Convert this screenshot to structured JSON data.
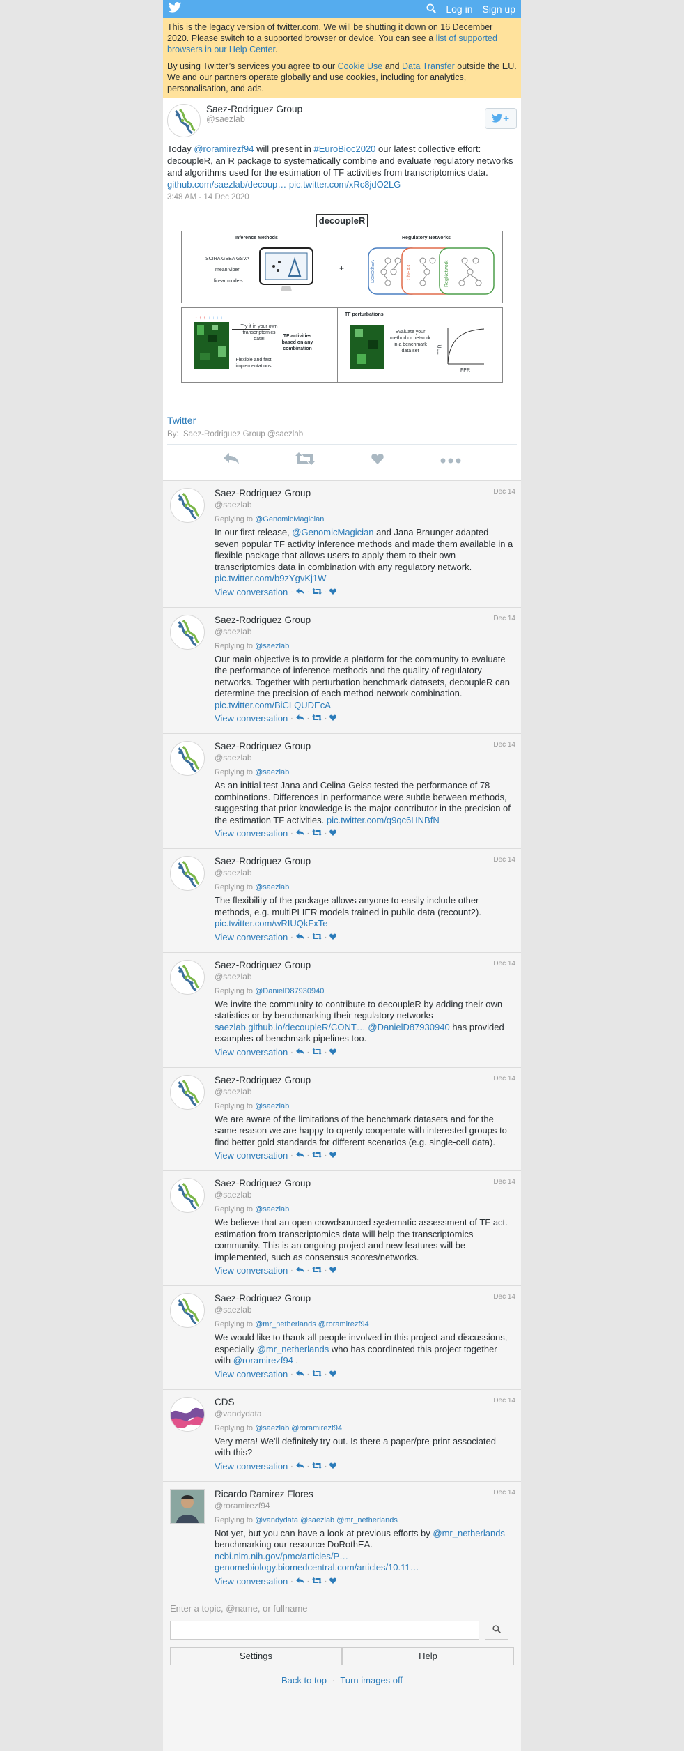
{
  "topbar": {
    "login": "Log in",
    "signup": "Sign up"
  },
  "legacy": {
    "p1_text": "This is the legacy version of twitter.com. We will be shutting it down on 16 December 2020. Please switch to a supported browser or device. You can see a",
    "p1_link": "list of supported browsers in our Help Center",
    "p1_end": ".",
    "p2_a": "By using Twitter’s services you agree to our",
    "p2_link1": "Cookie Use",
    "p2_and": "and",
    "p2_link2": "Data Transfer",
    "p2_b": "outside the EU. We and our partners operate globally and use cookies, including for analytics, personalisation, and ads."
  },
  "main_tweet": {
    "name": "Saez-Rodriguez Group",
    "handle": "saezlab",
    "text_a": "Today",
    "mention": "@roramirezf94",
    "text_b": "will present in",
    "hashtag": "#EuroBioc2020",
    "text_c": "our latest collective effort: decoupleR, an R package to systematically combine and evaluate regulatory networks and algorithms used for the estimation of TF activities from transcriptomics data.",
    "link1": "github.com/saezlab/decoup…",
    "link2": "pic.twitter.com/xRc8jdO2LG",
    "time": "3:48 AM - 14 Dec 2020",
    "card": {
      "title": "decoupleR",
      "inference_methods": "Inference Methods",
      "m1": "SCIRA GSEA GSVA",
      "m2": "mean viper",
      "m3": "linear models",
      "regulatory_networks": "Regulatory Networks",
      "net1": "DoRothEA",
      "net2": "ChEA3",
      "net3": "RegNetwork",
      "try_text": "Try it in your own transcriptomics data!",
      "flex_text": "Flexible and fast implementations",
      "tf_text": "TF activities based on any combination",
      "tf_perturb": "TF perturbations",
      "eval_text": "Evaluate your method or network in a benchmark data set",
      "tpr": "TPR",
      "fpr": "FPR"
    },
    "twitter_link": "Twitter",
    "by_label": "By:",
    "by_name": "Saez-Rodriguez Group",
    "by_handle": "@saezlab"
  },
  "replies": [
    {
      "name": "Saez-Rodriguez Group",
      "handle": "saezlab",
      "date": "Dec 14",
      "replying_label": "Replying to",
      "replying_to": "@GenomicMagician",
      "text_a": "In our first release,",
      "mention": "@GenomicMagician",
      "text_b": "and Jana Braunger adapted seven popular TF activity inference methods and made them available in a flexible package that allows users to apply them to their own transcriptomics data in combination with any regulatory network.",
      "link": "pic.twitter.com/b9zYgvKj1W",
      "view": "View conversation"
    },
    {
      "name": "Saez-Rodriguez Group",
      "handle": "saezlab",
      "date": "Dec 14",
      "replying_label": "Replying to",
      "replying_to": "@saezlab",
      "text_a": "Our main objective is to provide a platform for the community to evaluate the performance of inference methods and the quality of regulatory networks. Together with perturbation benchmark datasets, decoupleR can determine the precision of each method-network combination.",
      "link": "pic.twitter.com/BiCLQUDEcA",
      "view": "View conversation"
    },
    {
      "name": "Saez-Rodriguez Group",
      "handle": "saezlab",
      "date": "Dec 14",
      "replying_label": "Replying to",
      "replying_to": "@saezlab",
      "text_a": "As an initial test Jana and Celina Geiss tested the performance of 78 combinations. Differences in performance were subtle between methods, suggesting that prior knowledge is the major contributor in the precision of the estimation TF activities.",
      "link": "pic.twitter.com/q9qc6HNBfN",
      "view": "View conversation"
    },
    {
      "name": "Saez-Rodriguez Group",
      "handle": "saezlab",
      "date": "Dec 14",
      "replying_label": "Replying to",
      "replying_to": "@saezlab",
      "text_a": "The flexibility of the package allows anyone to easily include other methods, e.g. multiPLIER models trained in public data (recount2).",
      "link": "pic.twitter.com/wRIUQkFxTe",
      "view": "View conversation"
    },
    {
      "name": "Saez-Rodriguez Group",
      "handle": "saezlab",
      "date": "Dec 14",
      "replying_label": "Replying to",
      "replying_to": "@DanielD87930940",
      "text_a": "We invite the community to contribute to decoupleR by adding their own statistics or by benchmarking their regulatory networks",
      "link": "saezlab.github.io/decoupleR/CONT…",
      "mention": "@DanielD87930940",
      "text_b": "has provided examples of benchmark pipelines too.",
      "view": "View conversation"
    },
    {
      "name": "Saez-Rodriguez Group",
      "handle": "saezlab",
      "date": "Dec 14",
      "replying_label": "Replying to",
      "replying_to": "@saezlab",
      "text_a": "We are aware of the limitations of the benchmark datasets and for the same reason we are happy to openly cooperate with interested groups to find better gold standards for different scenarios (e.g. single-cell data).",
      "view": "View conversation"
    },
    {
      "name": "Saez-Rodriguez Group",
      "handle": "saezlab",
      "date": "Dec 14",
      "replying_label": "Replying to",
      "replying_to": "@saezlab",
      "text_a": "We believe that an open crowdsourced systematic assessment of TF act. estimation from transcriptomics data will help the transcriptomics community. This is an ongoing project and new features will be implemented, such as consensus scores/networks.",
      "view": "View conversation"
    },
    {
      "name": "Saez-Rodriguez Group",
      "handle": "saezlab",
      "date": "Dec 14",
      "replying_label": "Replying to",
      "replying_to": "@mr_netherlands @roramirezf94",
      "text_a": "We would like to thank all people involved in this project and discussions, especially",
      "mention": "@mr_netherlands",
      "text_b": "who has coordinated this project together with",
      "mention2": "@roramirezf94",
      "text_c": ".",
      "view": "View conversation"
    },
    {
      "name": "CDS",
      "handle": "vandydata",
      "date": "Dec 14",
      "replying_label": "Replying to",
      "replying_to": "@saezlab @roramirezf94",
      "text_a": "Very meta! We'll definitely try out. Is there a paper/pre-print associated with this?",
      "view": "View conversation"
    },
    {
      "name": "Ricardo Ramirez Flores",
      "handle": "roramirezf94",
      "date": "Dec 14",
      "replying_label": "Replying to",
      "replying_to": "@vandydata @saezlab @mr_netherlands",
      "text_a": "Not yet, but you can have a look at previous efforts by",
      "mention": "@mr_netherlands",
      "text_b": "benchmarking our resource DoRothEA.",
      "link": "ncbi.nlm.nih.gov/pmc/articles/P…",
      "link2": "genomebiology.biomedcentral.com/articles/10.11…",
      "view": "View conversation"
    }
  ],
  "search": {
    "placeholder": "Enter a topic, @name, or fullname"
  },
  "footer": {
    "settings": "Settings",
    "help": "Help",
    "back_to_top": "Back to top",
    "turn_images_off": "Turn images off"
  }
}
